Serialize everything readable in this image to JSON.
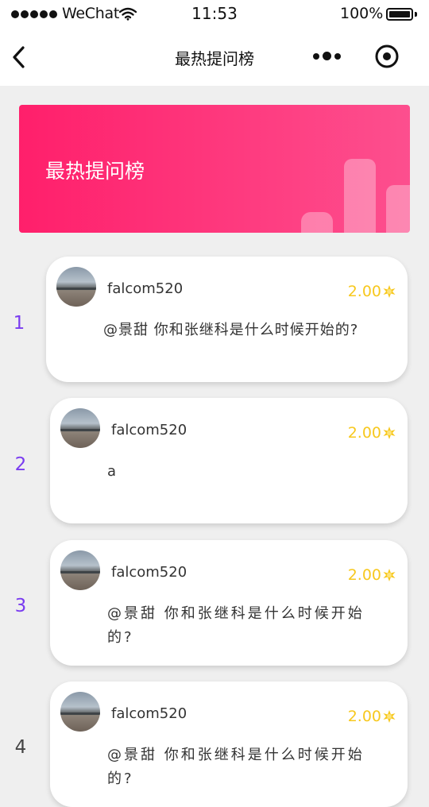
{
  "status_bar": {
    "carrier": "WeChat",
    "time": "11:53",
    "battery": "100%"
  },
  "nav": {
    "title": "最热提问榜"
  },
  "banner": {
    "title": "最热提问榜"
  },
  "questions": [
    {
      "rank": "1",
      "username": "falcom520",
      "reward": "2.00",
      "text": "@景甜 你和张继科是什么时候开始的?"
    },
    {
      "rank": "2",
      "username": "falcom520",
      "reward": "2.00",
      "text": "a"
    },
    {
      "rank": "3",
      "username": "falcom520",
      "reward": "2.00",
      "text": "@景甜 你和张继科是什么时候开始的?"
    },
    {
      "rank": "4",
      "username": "falcom520",
      "reward": "2.00",
      "text": "@景甜 你和张继科是什么时候开始的?"
    }
  ],
  "icons": {
    "back": "chevron-left-icon",
    "more": "more-dots-icon",
    "close": "close-miniprogram-icon",
    "reward": "coin-icon"
  },
  "colors": {
    "banner_start": "#ff1f6b",
    "banner_end": "#fd4f8e",
    "rank": "#7a3cf0",
    "reward": "#f7c81e"
  }
}
